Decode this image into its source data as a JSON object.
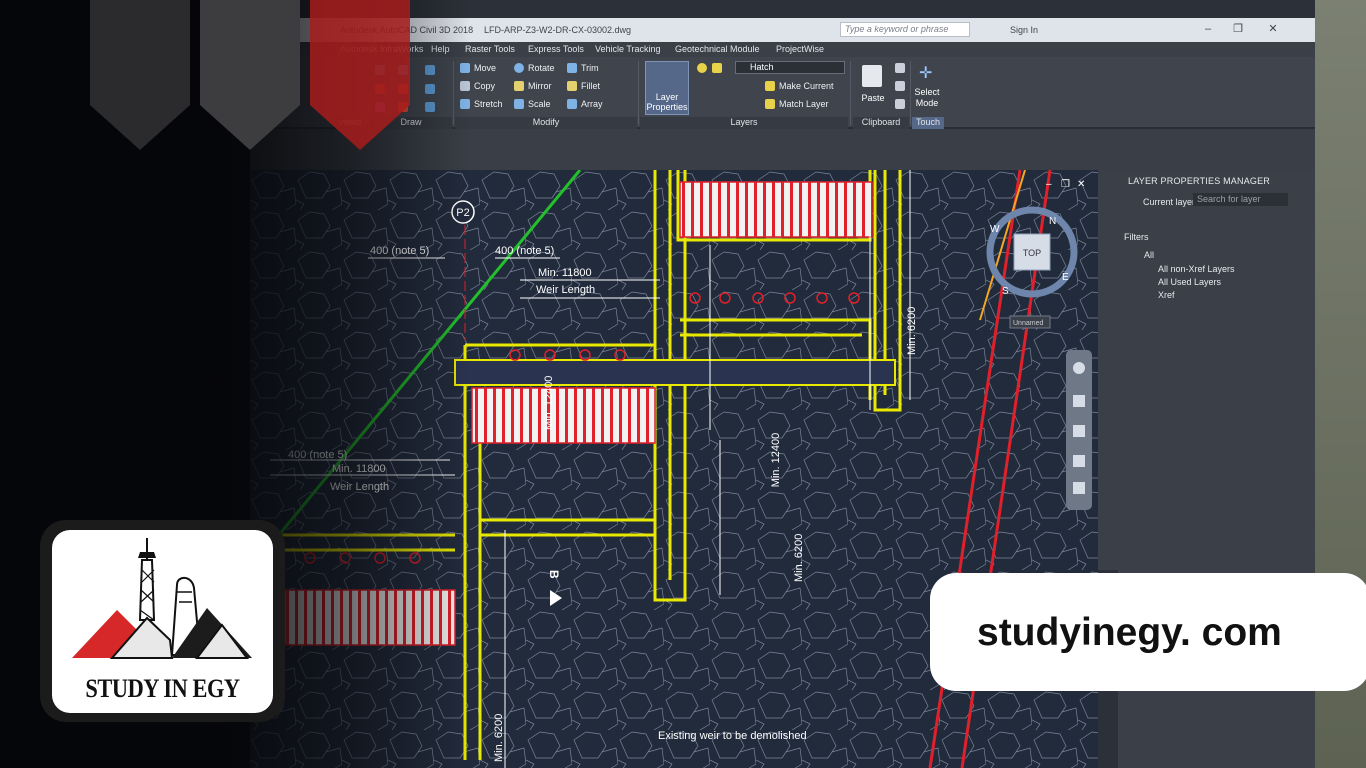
{
  "app": {
    "title": "Autodesk AutoCAD Civil 3D 2018",
    "file": "LFD-ARP-Z3-W2-DR-CX-03002.dwg",
    "search_placeholder": "Type a keyword or phrase",
    "sign_in": "Sign In"
  },
  "menubar": {
    "items": [
      "Autodesk InfraWorks",
      "Help",
      "Raster Tools",
      "Express Tools",
      "Vehicle Tracking",
      "Geotechnical Module",
      "ProjectWise"
    ]
  },
  "ribbon": {
    "modify": {
      "move": "Move",
      "rotate": "Rotate",
      "trim": "Trim",
      "copy": "Copy",
      "mirror": "Mirror",
      "fillet": "Fillet",
      "stretch": "Stretch",
      "scale": "Scale",
      "array": "Array"
    },
    "layers": {
      "layer_properties_1": "Layer",
      "layer_properties_2": "Properties",
      "hatch": "Hatch",
      "make_current": "Make Current",
      "match_layer": "Match Layer"
    },
    "clipboard": {
      "paste": "Paste"
    },
    "touch": {
      "select_mode_1": "Select",
      "select_mode_2": "Mode"
    },
    "panels": {
      "views": "views",
      "draw": "Draw",
      "modify": "Modify",
      "layers": "Layers",
      "clipboard": "Clipboard",
      "touch": "Touch"
    }
  },
  "layer_manager": {
    "title": "LAYER PROPERTIES MANAGER",
    "current_layer": "Current layer",
    "search": "Search for layer",
    "filters": "Filters",
    "tree": [
      "All",
      "All non-Xref Layers",
      "All Used Layers",
      "Xref"
    ]
  },
  "viewcube": {
    "top": "TOP",
    "unnamed": "Unnamed",
    "n": "N",
    "e": "E",
    "s": "S",
    "w": "W"
  },
  "drawing": {
    "grid_label": "P2",
    "section_label": "B",
    "dim_400_a": "400 (note 5)",
    "dim_400_b": "400 (note 5)",
    "dim_400_c": "400 (note 5)",
    "min_11800_a": "Min. 11800",
    "weir_a": "Weir Length",
    "min_11800_b": "Min. 11800",
    "weir_b": "Weir Length",
    "min_12400_a": "Min. 12400",
    "min_12400_b": "Min. 12400",
    "min_6200_a": "Min. 6200",
    "min_6200_b": "Min. 6200",
    "min_6200_c": "Min. 6200",
    "existing_weir": "Existing weir to be demolished"
  },
  "logo": {
    "text": "STUDY IN EGY"
  },
  "website": {
    "url": "studyinegy. com"
  },
  "colors": {
    "accent_yellow": "#e8e800",
    "accent_red": "#e0202a",
    "accent_green": "#22c02a",
    "cad_bg": "#222b3c"
  }
}
